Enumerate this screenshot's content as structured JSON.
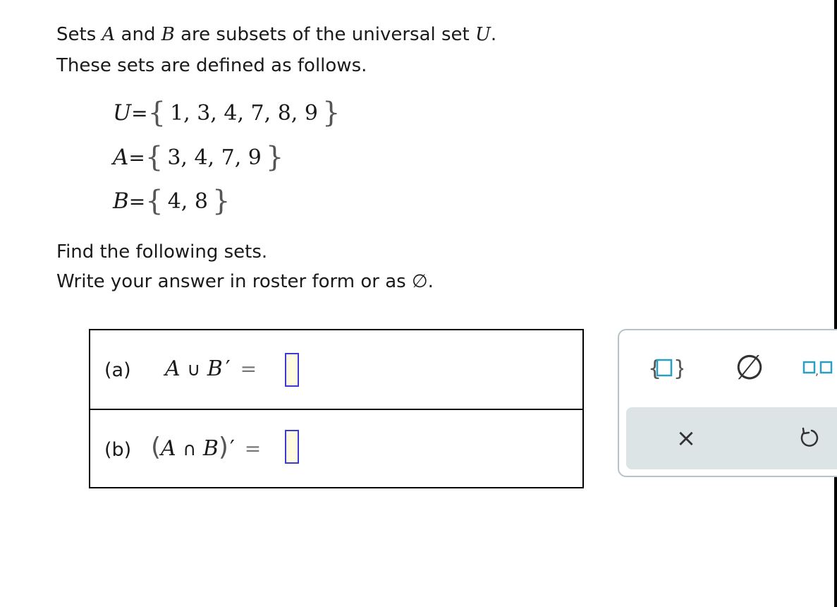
{
  "intro": {
    "line1_parts": [
      "Sets ",
      "A",
      " and ",
      "B",
      " are subsets of the universal set ",
      "U",
      "."
    ],
    "line2": "These sets are defined as follows."
  },
  "sets": [
    {
      "name": "U",
      "elements": "1,  3,  4,  7,  8,  9"
    },
    {
      "name": "A",
      "elements": "3,  4,  7,  9"
    },
    {
      "name": "B",
      "elements": "4,  8"
    }
  ],
  "symbols": {
    "eq": "=",
    "lbrace": "{",
    "rbrace": "}",
    "union": "∪",
    "intersect": "∩",
    "prime": "′",
    "lparen": "(",
    "rparen": ")"
  },
  "instructions": {
    "line1": "Find the following sets.",
    "line2": "Write your answer in roster form or as ∅."
  },
  "parts": [
    {
      "label": "(a)",
      "lhs": "A",
      "op": "∪",
      "rhs": "B"
    },
    {
      "label": "(b)",
      "lhs": "A",
      "op": "∩",
      "rhs": "B"
    }
  ],
  "keypad": {
    "set_key_icon": "set-braces-icon",
    "empty_set_key": "∅",
    "list_key_icon": "list-comma-icon",
    "clear_key": "×",
    "undo_key": "↺"
  },
  "colors": {
    "input_border": "#3a3ad6",
    "input_fill": "#fffbe0",
    "keypad_icon": "#2a9fbf",
    "keypad_bar": "#dde4e6"
  }
}
